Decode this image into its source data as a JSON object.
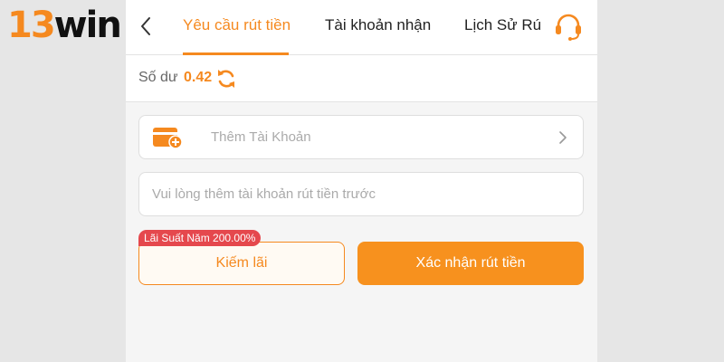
{
  "brand": {
    "logo_number": "13",
    "logo_word": "win",
    "accent_color": "#f5891f"
  },
  "header": {
    "back_icon": "chevron-left-icon",
    "tabs": [
      {
        "label": "Yêu cầu rút tiền",
        "active": true
      },
      {
        "label": "Tài khoản nhận",
        "active": false
      },
      {
        "label": "Lịch Sử Rú",
        "active": false
      }
    ],
    "support_icon": "headset-icon"
  },
  "balance": {
    "label": "Số dư",
    "value": "0.42",
    "refresh_icon": "refresh-icon"
  },
  "add_account": {
    "label": "Thêm Tài Khoản",
    "icon": "wallet-add-icon",
    "chevron_icon": "chevron-right-icon"
  },
  "withdraw_note": {
    "placeholder": "Vui lòng thêm tài khoản rút tiền trước"
  },
  "interest_badge": {
    "text": "Lãi Suất Năm 200.00%",
    "color": "#e5484d"
  },
  "buttons": {
    "earn_label": "Kiếm lãi",
    "confirm_label": "Xác nhận rút tiền"
  }
}
